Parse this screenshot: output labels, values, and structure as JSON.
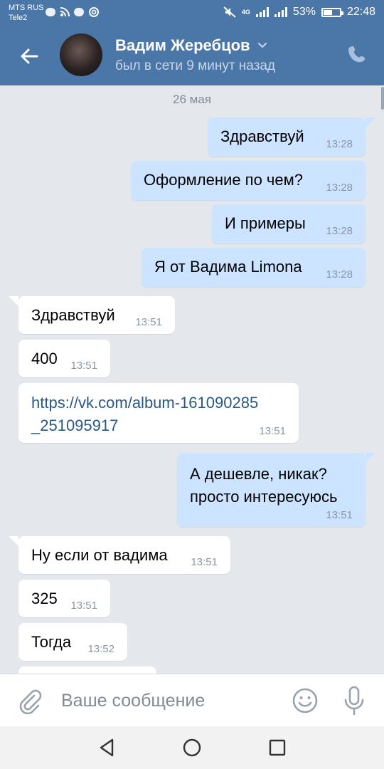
{
  "status_bar": {
    "carrier_1": "MTS RUS",
    "carrier_2": "Tele2",
    "network": "4G",
    "battery": "53%",
    "battery_level": 0.53,
    "time": "22:48"
  },
  "header": {
    "name": "Вадим Жеребцов",
    "status": "был в сети 9 минут назад"
  },
  "chat": {
    "date": "26 мая",
    "messages": [
      {
        "dir": "out",
        "text": "Здравствуй",
        "time": "13:28"
      },
      {
        "dir": "out",
        "text": "Оформление по чем?",
        "time": "13:28"
      },
      {
        "dir": "out",
        "text": "И примеры",
        "time": "13:28"
      },
      {
        "dir": "out",
        "text": "Я от Вадима Limona",
        "time": "13:28"
      },
      {
        "dir": "in",
        "text": "Здравствуй",
        "time": "13:51"
      },
      {
        "dir": "in",
        "text": "400",
        "time": "13:51"
      },
      {
        "dir": "in",
        "text_line1": "https://vk.com/album-161090285",
        "text_line2": "_251095917",
        "time": "13:51"
      },
      {
        "dir": "out",
        "text_line1": "А дешевле, никак?",
        "text_line2": "просто интересуюсь",
        "time": "13:51"
      },
      {
        "dir": "in",
        "text": "Ну если от вадима",
        "time": "13:51"
      },
      {
        "dir": "in",
        "text": "325",
        "time": "13:51"
      },
      {
        "dir": "in",
        "text": "Тогда",
        "time": "13:52"
      }
    ]
  },
  "composer": {
    "placeholder": "Ваше сообщение"
  },
  "icons": {
    "back": "arrow-left-icon",
    "phone": "phone-icon",
    "attach": "paperclip-icon",
    "emoji": "smile-icon",
    "voice": "microphone-icon",
    "nav": [
      "back-triangle-icon",
      "home-circle-icon",
      "recents-square-icon"
    ]
  },
  "colors": {
    "header": "#4a76a8",
    "outgoing_bubble": "#cce4ff",
    "incoming_bubble": "#ffffff",
    "chat_background": "#e4e8ed",
    "link": "#2a5885"
  }
}
